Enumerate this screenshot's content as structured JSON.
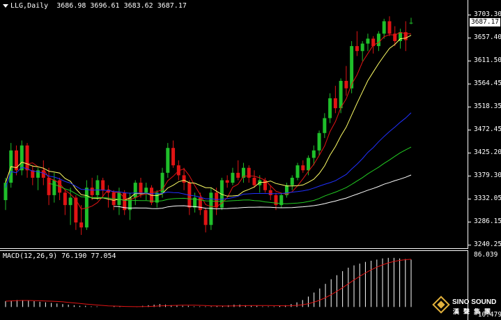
{
  "window": {
    "symbol_label": "LLG,Daily",
    "ohlc": "3686.98 3696.61 3683.62 3687.17"
  },
  "macd": {
    "label": "MACD(12,26,9) 76.190 77.054",
    "axis_top": "86.039",
    "axis_bottom": "-10.479"
  },
  "price_axis": {
    "current_price": "3687.17",
    "ticks": [
      "3703.30",
      "3657.40",
      "3611.50",
      "3564.45",
      "3518.35",
      "3472.45",
      "3425.20",
      "3379.30",
      "3332.05",
      "3286.15",
      "3240.25"
    ]
  },
  "logo": {
    "line1": "SINO SOUND",
    "line2": "漢聲集團"
  },
  "colors": {
    "bull_candle": "#1fbf2a",
    "bear_candle": "#e01414",
    "ma_fast": "#e01414",
    "ma_mid": "#ffff66",
    "ma_blue": "#2030ff",
    "ma_green": "#22cc22",
    "ma_white": "#ffffff",
    "macd_signal": "#e01414",
    "macd_hist": "#ffffff"
  },
  "chart_data": {
    "type": "candlestick",
    "ylim": [
      3240.25,
      3703.3
    ],
    "candles": [
      [
        3330,
        3375,
        3310,
        3365
      ],
      [
        3365,
        3445,
        3355,
        3430
      ],
      [
        3430,
        3440,
        3380,
        3390
      ],
      [
        3390,
        3450,
        3380,
        3440
      ],
      [
        3440,
        3445,
        3375,
        3390
      ],
      [
        3390,
        3400,
        3360,
        3375
      ],
      [
        3375,
        3395,
        3350,
        3390
      ],
      [
        3390,
        3410,
        3360,
        3375
      ],
      [
        3375,
        3395,
        3320,
        3340
      ],
      [
        3340,
        3385,
        3325,
        3370
      ],
      [
        3370,
        3375,
        3330,
        3345
      ],
      [
        3345,
        3350,
        3300,
        3320
      ],
      [
        3320,
        3355,
        3280,
        3335
      ],
      [
        3335,
        3340,
        3270,
        3285
      ],
      [
        3285,
        3320,
        3260,
        3275
      ],
      [
        3275,
        3370,
        3270,
        3355
      ],
      [
        3355,
        3375,
        3330,
        3340
      ],
      [
        3340,
        3380,
        3330,
        3370
      ],
      [
        3370,
        3375,
        3335,
        3350
      ],
      [
        3350,
        3360,
        3315,
        3345
      ],
      [
        3345,
        3350,
        3310,
        3320
      ],
      [
        3320,
        3355,
        3300,
        3345
      ],
      [
        3345,
        3350,
        3300,
        3310
      ],
      [
        3310,
        3345,
        3290,
        3335
      ],
      [
        3335,
        3370,
        3320,
        3365
      ],
      [
        3365,
        3375,
        3335,
        3345
      ],
      [
        3345,
        3365,
        3330,
        3355
      ],
      [
        3355,
        3360,
        3320,
        3325
      ],
      [
        3325,
        3350,
        3315,
        3345
      ],
      [
        3345,
        3395,
        3335,
        3385
      ],
      [
        3385,
        3445,
        3375,
        3435
      ],
      [
        3435,
        3450,
        3395,
        3400
      ],
      [
        3400,
        3410,
        3370,
        3380
      ],
      [
        3380,
        3395,
        3350,
        3365
      ],
      [
        3365,
        3370,
        3300,
        3315
      ],
      [
        3315,
        3345,
        3305,
        3335
      ],
      [
        3335,
        3345,
        3300,
        3310
      ],
      [
        3310,
        3315,
        3265,
        3280
      ],
      [
        3280,
        3355,
        3270,
        3345
      ],
      [
        3345,
        3355,
        3300,
        3315
      ],
      [
        3315,
        3375,
        3310,
        3370
      ],
      [
        3370,
        3380,
        3355,
        3365
      ],
      [
        3365,
        3395,
        3360,
        3385
      ],
      [
        3385,
        3410,
        3370,
        3375
      ],
      [
        3375,
        3405,
        3365,
        3395
      ],
      [
        3395,
        3400,
        3365,
        3375
      ],
      [
        3375,
        3390,
        3355,
        3360
      ],
      [
        3360,
        3380,
        3345,
        3370
      ],
      [
        3370,
        3375,
        3345,
        3350
      ],
      [
        3350,
        3360,
        3330,
        3340
      ],
      [
        3340,
        3345,
        3310,
        3320
      ],
      [
        3320,
        3345,
        3315,
        3340
      ],
      [
        3340,
        3365,
        3335,
        3360
      ],
      [
        3360,
        3380,
        3350,
        3375
      ],
      [
        3375,
        3405,
        3370,
        3400
      ],
      [
        3400,
        3410,
        3385,
        3390
      ],
      [
        3390,
        3420,
        3380,
        3415
      ],
      [
        3415,
        3440,
        3400,
        3430
      ],
      [
        3430,
        3470,
        3420,
        3465
      ],
      [
        3465,
        3505,
        3455,
        3495
      ],
      [
        3495,
        3545,
        3485,
        3535
      ],
      [
        3535,
        3560,
        3505,
        3515
      ],
      [
        3515,
        3575,
        3505,
        3570
      ],
      [
        3570,
        3600,
        3540,
        3555
      ],
      [
        3555,
        3650,
        3545,
        3640
      ],
      [
        3640,
        3670,
        3620,
        3630
      ],
      [
        3630,
        3650,
        3610,
        3645
      ],
      [
        3645,
        3665,
        3630,
        3655
      ],
      [
        3655,
        3660,
        3625,
        3640
      ],
      [
        3640,
        3670,
        3630,
        3665
      ],
      [
        3665,
        3695,
        3655,
        3690
      ],
      [
        3690,
        3700,
        3660,
        3665
      ],
      [
        3665,
        3680,
        3640,
        3650
      ],
      [
        3650,
        3675,
        3635,
        3668
      ],
      [
        3668,
        3690,
        3630,
        3652
      ],
      [
        3687,
        3697,
        3684,
        3687
      ]
    ],
    "macd_hist": [
      10,
      11,
      12,
      12,
      11,
      10,
      9,
      8,
      7,
      6,
      5,
      4,
      3,
      2,
      2,
      1,
      1,
      0,
      0,
      1,
      1,
      0,
      0,
      1,
      2,
      3,
      4,
      5,
      4,
      3,
      3,
      2,
      2,
      1,
      1,
      1,
      1,
      2,
      2,
      3,
      4,
      4,
      3,
      2,
      2,
      1,
      1,
      1,
      2,
      3,
      5,
      8,
      12,
      18,
      25,
      32,
      40,
      48,
      55,
      62,
      68,
      72,
      75,
      78,
      80,
      82,
      84,
      85,
      85,
      84,
      83,
      82
    ],
    "macd_range": [
      -10.479,
      86.039
    ]
  }
}
